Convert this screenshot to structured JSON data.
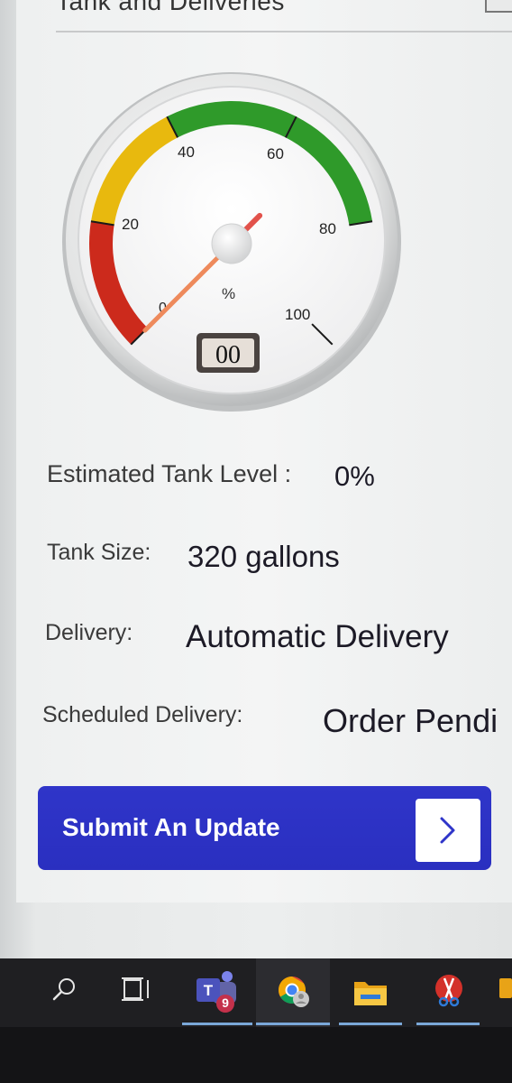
{
  "header": {
    "title": "Tank and Deliveries"
  },
  "gauge": {
    "ticks": [
      "0",
      "20",
      "40",
      "60",
      "80",
      "100"
    ],
    "unit": "%",
    "readout": "00",
    "value_percent": 0,
    "colors": {
      "low": "#cc2a1c",
      "mid": "#e8b90e",
      "high": "#2f9a2a"
    }
  },
  "details": {
    "level_label": "Estimated Tank Level :",
    "level_value": "0%",
    "size_label": "Tank Size:",
    "size_value": "320 gallons",
    "delivery_label": "Delivery:",
    "delivery_value": "Automatic Delivery",
    "scheduled_label": "Scheduled Delivery:",
    "scheduled_value": "Order Pendi"
  },
  "submit": {
    "label": "Submit An Update",
    "arrow_icon": "chevron-right-icon",
    "color": "#2f35c9"
  },
  "taskbar": {
    "items": [
      {
        "icon": "search-icon"
      },
      {
        "icon": "task-view-icon"
      },
      {
        "icon": "teams-icon",
        "badge": "9"
      },
      {
        "icon": "chrome-icon"
      },
      {
        "icon": "file-explorer-icon"
      },
      {
        "icon": "snipping-tool-icon"
      }
    ]
  }
}
